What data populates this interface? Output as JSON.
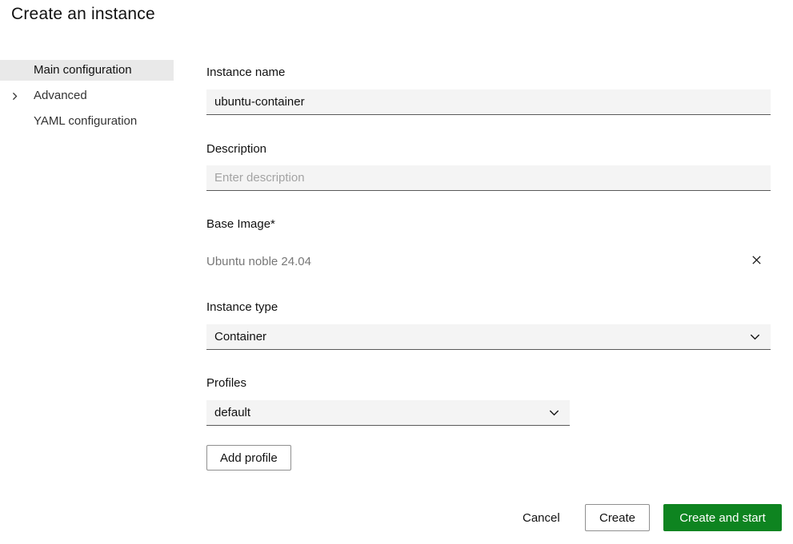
{
  "page": {
    "title": "Create an instance"
  },
  "sidebar": {
    "items": [
      {
        "label": "Main configuration",
        "selected": true
      },
      {
        "label": "Advanced",
        "expandable": true
      },
      {
        "label": "YAML configuration",
        "selected": false
      }
    ]
  },
  "form": {
    "instance_name": {
      "label": "Instance name",
      "value": "ubuntu-container"
    },
    "description": {
      "label": "Description",
      "placeholder": "Enter description"
    },
    "base_image": {
      "label": "Base Image*",
      "value": "Ubuntu noble 24.04"
    },
    "instance_type": {
      "label": "Instance type",
      "value": "Container"
    },
    "profiles": {
      "label": "Profiles",
      "value": "default"
    },
    "add_profile_label": "Add profile"
  },
  "footer": {
    "cancel_label": "Cancel",
    "create_label": "Create",
    "create_and_start_label": "Create and start"
  },
  "icons": {
    "advanced_chevron": "chevron-right-icon",
    "base_image_clear": "close-icon",
    "select_dropdown": "chevron-down-icon"
  },
  "colors": {
    "accent_green": "#0e8420",
    "input_bg": "#f4f4f4",
    "selected_item_bg": "#e9e9e9",
    "input_border": "#595959",
    "muted_text": "#777777"
  }
}
